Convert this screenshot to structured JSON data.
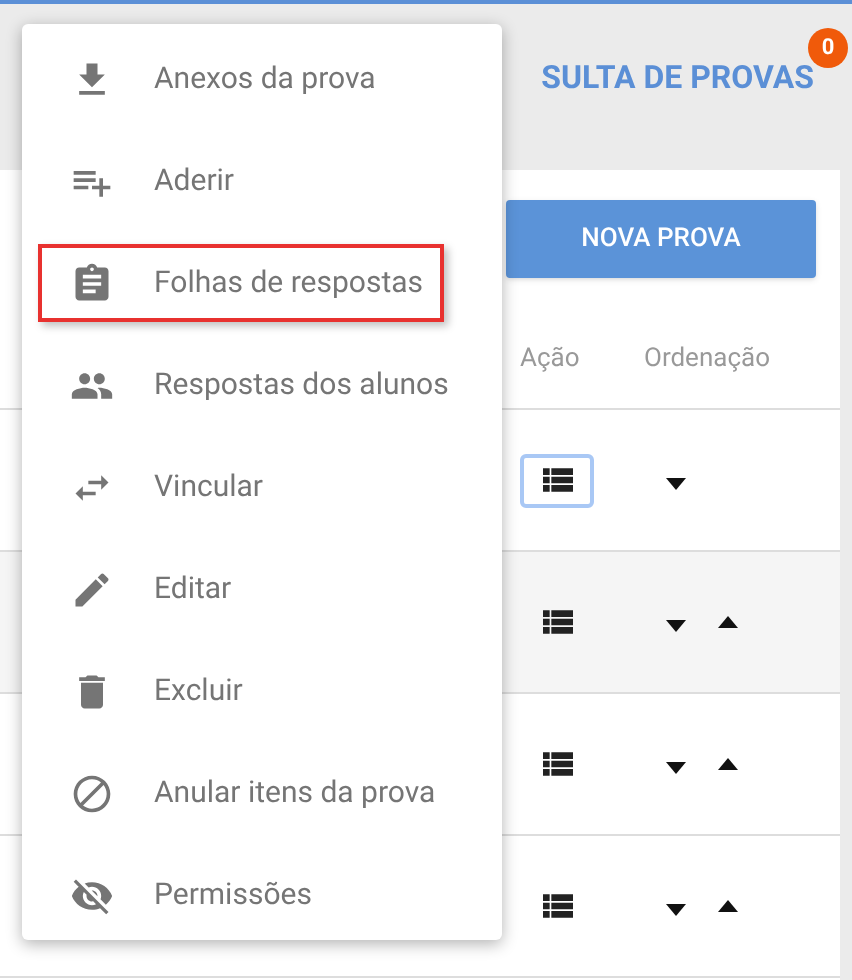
{
  "header": {
    "title": "SULTA DE PROVAS",
    "notification_count": "0"
  },
  "new_button": "NOVA PROVA",
  "columns": [
    "Ação",
    "Ordenação"
  ],
  "rows": [
    {
      "focused": true,
      "shaded": false,
      "can_move_down": true,
      "can_move_up": false
    },
    {
      "focused": false,
      "shaded": true,
      "can_move_down": true,
      "can_move_up": true
    },
    {
      "focused": false,
      "shaded": false,
      "can_move_down": true,
      "can_move_up": true
    },
    {
      "focused": false,
      "shaded": false,
      "can_move_down": true,
      "can_move_up": true
    }
  ],
  "menu": [
    {
      "label": "Anexos da prova",
      "kind": "download",
      "highlighted": false
    },
    {
      "label": "Aderir",
      "kind": "playlist-add",
      "highlighted": false
    },
    {
      "label": "Folhas de respostas",
      "kind": "clipboard",
      "highlighted": true
    },
    {
      "label": "Respostas dos alunos",
      "kind": "people",
      "highlighted": false
    },
    {
      "label": "Vincular",
      "kind": "swap",
      "highlighted": false
    },
    {
      "label": "Editar",
      "kind": "pencil",
      "highlighted": false
    },
    {
      "label": "Excluir",
      "kind": "trash",
      "highlighted": false
    },
    {
      "label": "Anular itens da prova",
      "kind": "block",
      "highlighted": false
    },
    {
      "label": "Permissões",
      "kind": "eye-off",
      "highlighted": false
    }
  ]
}
